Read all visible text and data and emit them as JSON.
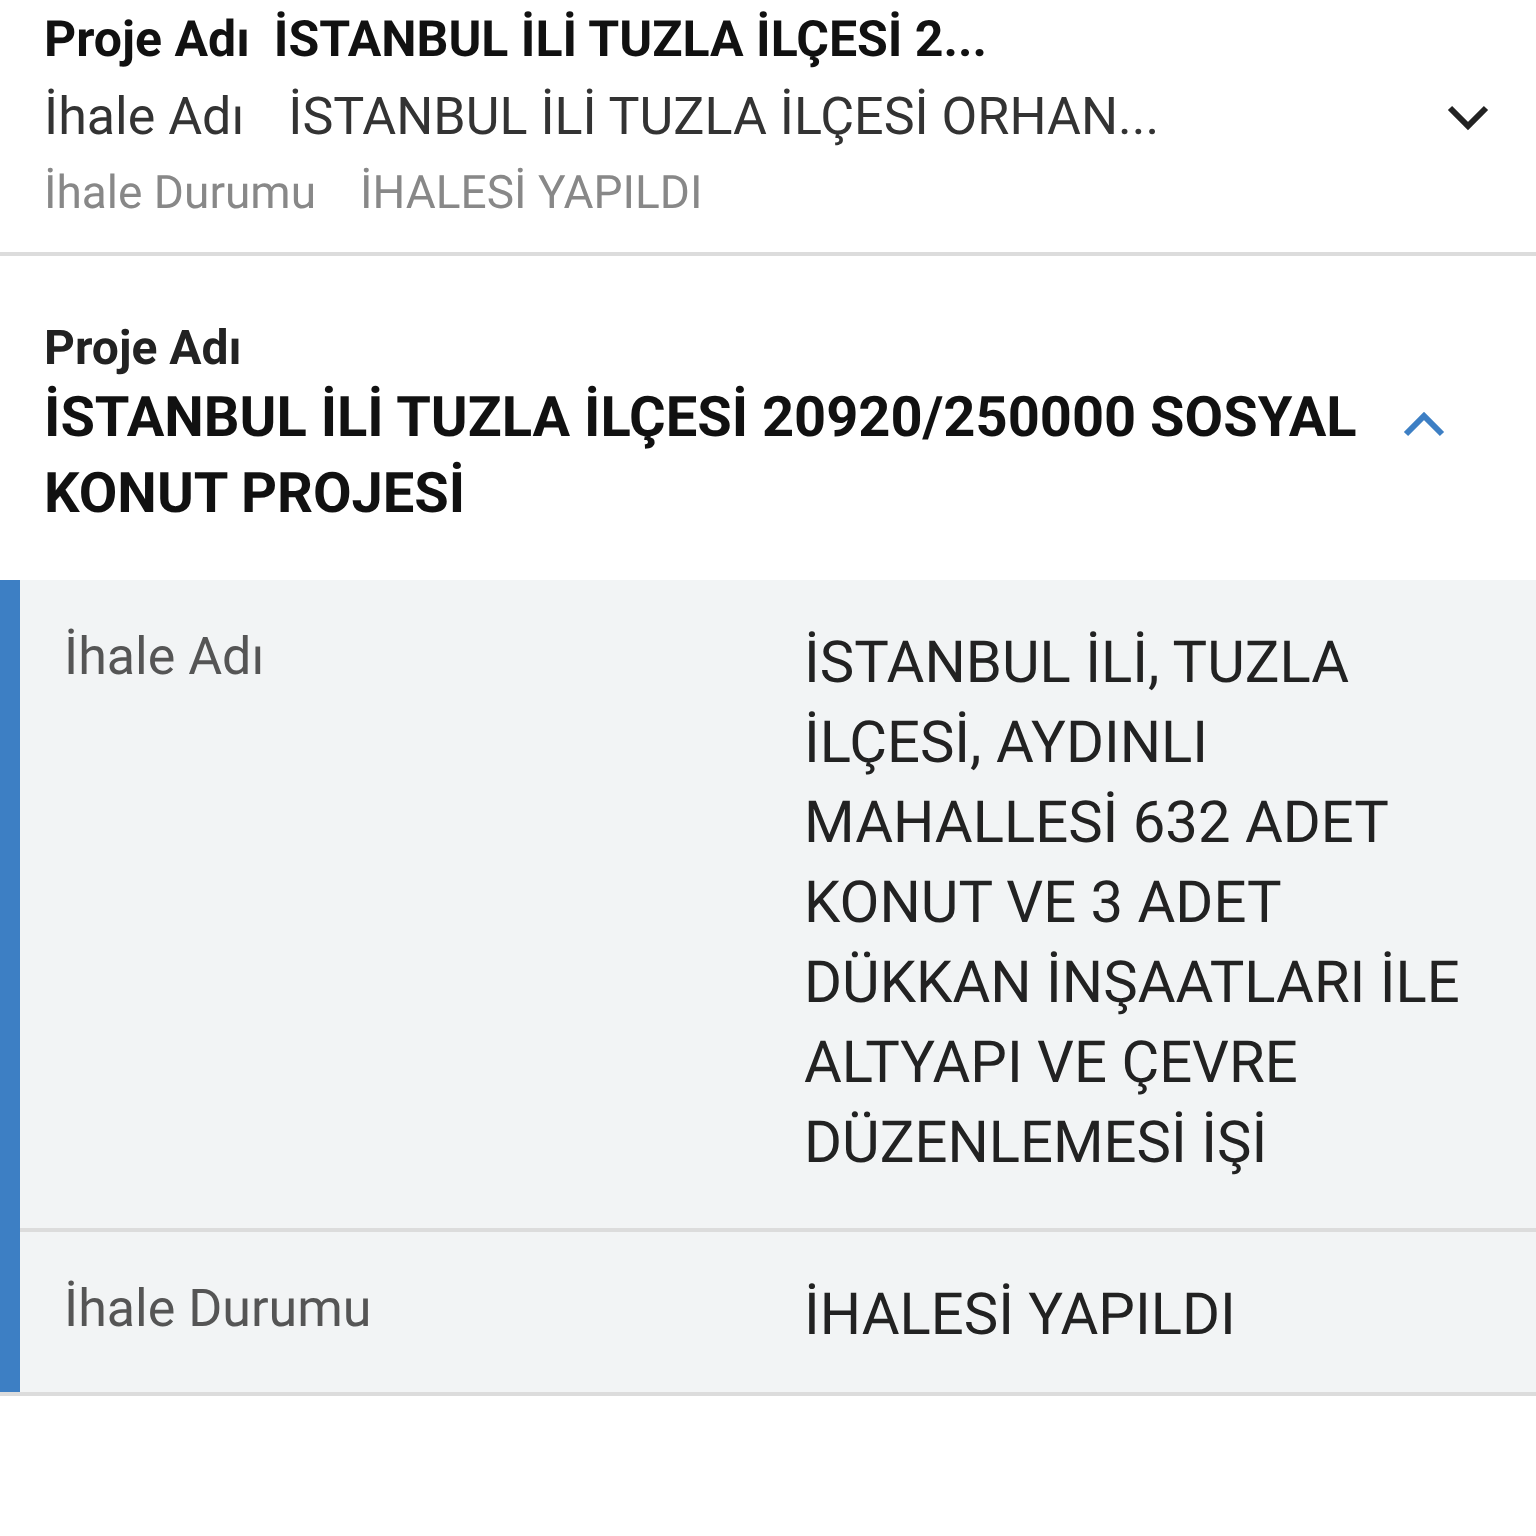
{
  "projects": [
    {
      "expanded": false,
      "project_label": "Proje Adı",
      "project_name": "İSTANBUL İLİ TUZLA İLÇESİ 2...",
      "fields": [
        {
          "label": "İhale Adı",
          "value": "İSTANBUL İLİ TUZLA İLÇESİ ORHAN..."
        },
        {
          "label": "İhale Durumu",
          "value": "İHALESİ YAPILDI"
        }
      ]
    },
    {
      "expanded": true,
      "project_label": "Proje Adı",
      "project_name": "İSTANBUL İLİ TUZLA İLÇESİ 20920/250000 SOSYAL KONUT PROJESİ",
      "fields": [
        {
          "label": "İhale Adı",
          "value": "İSTANBUL İLİ, TUZLA İLÇESİ, AYDINLI MAHALLESİ 632 ADET KONUT VE 3 ADET DÜKKAN İNŞAATLARI İLE ALTYAPI VE ÇEVRE DÜZENLEMESİ İŞİ"
        },
        {
          "label": "İhale Durumu",
          "value": "İHALESİ YAPILDI"
        }
      ]
    }
  ]
}
